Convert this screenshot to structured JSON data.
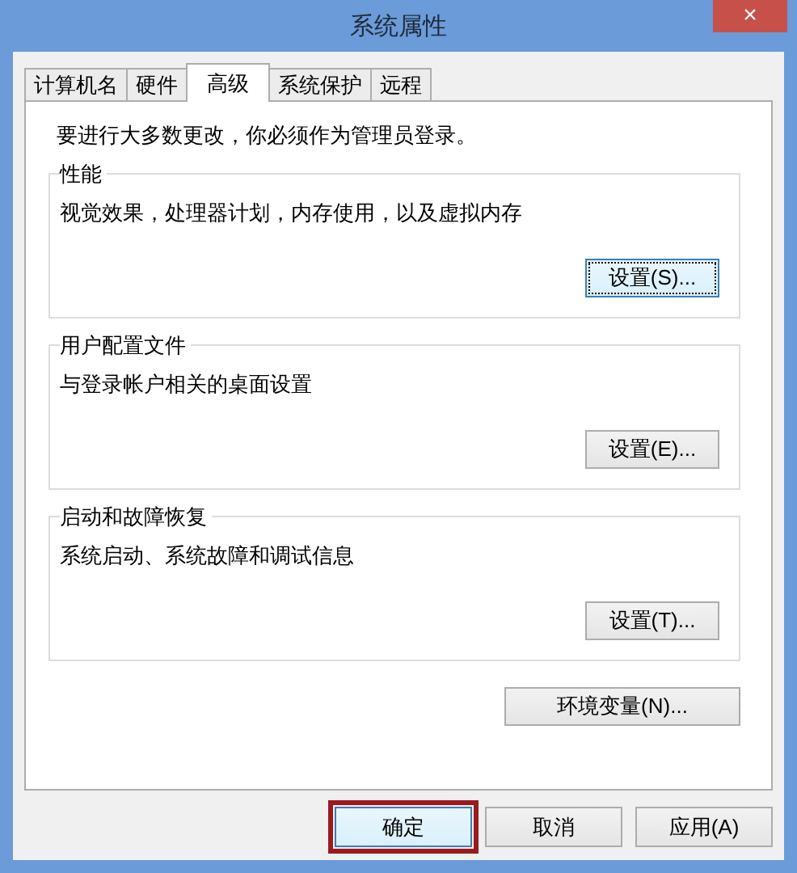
{
  "window": {
    "title": "系统属性",
    "close": "×"
  },
  "tabs": [
    {
      "label": "计算机名",
      "selected": false
    },
    {
      "label": "硬件",
      "selected": false
    },
    {
      "label": "高级",
      "selected": true
    },
    {
      "label": "系统保护",
      "selected": false
    },
    {
      "label": "远程",
      "selected": false
    }
  ],
  "notice": "要进行大多数更改，你必须作为管理员登录。",
  "groups": [
    {
      "title": "性能",
      "description": "视觉效果，处理器计划，内存使用，以及虚拟内存",
      "button": {
        "label": "设置(S)...",
        "focused": true
      }
    },
    {
      "title": "用户配置文件",
      "description": "与登录帐户相关的桌面设置",
      "button": {
        "label": "设置(E)...",
        "focused": false
      }
    },
    {
      "title": "启动和故障恢复",
      "description": "系统启动、系统故障和调试信息",
      "button": {
        "label": "设置(T)...",
        "focused": false
      }
    }
  ],
  "env_button": "环境变量(N)...",
  "buttons": [
    {
      "label": "确定",
      "highlighted": true
    },
    {
      "label": "取消",
      "highlighted": false
    },
    {
      "label": "应用(A)",
      "highlighted": false
    }
  ]
}
